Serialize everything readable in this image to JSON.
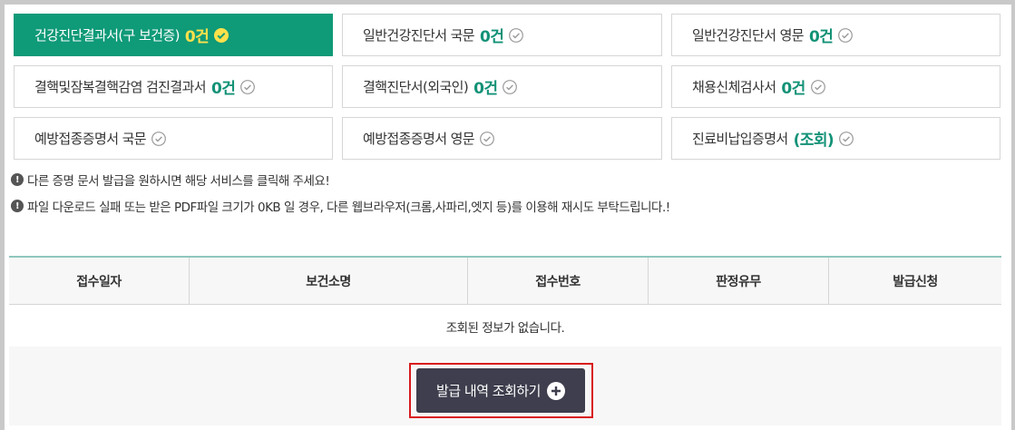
{
  "tiles": [
    {
      "label": "건강진단결과서(구 보건증)",
      "count": "0건",
      "active": true
    },
    {
      "label": "일반건강진단서 국문",
      "count": "0건"
    },
    {
      "label": "일반건강진단서 영문",
      "count": "0건"
    },
    {
      "label": "결핵및잠복결핵감염 검진결과서",
      "count": "0건"
    },
    {
      "label": "결핵진단서(외국인)",
      "count": "0건"
    },
    {
      "label": "채용신체검사서",
      "count": "0건"
    },
    {
      "label": "예방접종증명서 국문",
      "count": ""
    },
    {
      "label": "예방접종증명서 영문",
      "count": ""
    },
    {
      "label": "진료비납입증명서",
      "count": "(조회)"
    }
  ],
  "notices": [
    "다른 증명 문서 발급을 원하시면 해당 서비스를 클릭해 주세요!",
    "파일 다운로드 실패 또는 받은 PDF파일 크기가 0KB 일 경우, 다른 웹브라우저(크롬,사파리,엣지 등)를 이용해 재시도 부탁드립니다.!"
  ],
  "table": {
    "headers": [
      "접수일자",
      "보건소명",
      "접수번호",
      "판정유무",
      "발급신청"
    ],
    "empty_message": "조회된 정보가 없습니다."
  },
  "button": {
    "label": "발급 내역 조회하기"
  },
  "colors": {
    "active_tile": "#0f9a78",
    "count_text": "#139277",
    "active_count": "#ffe14b",
    "button": "#3e3e4e",
    "highlight_frame": "#d9191b"
  }
}
